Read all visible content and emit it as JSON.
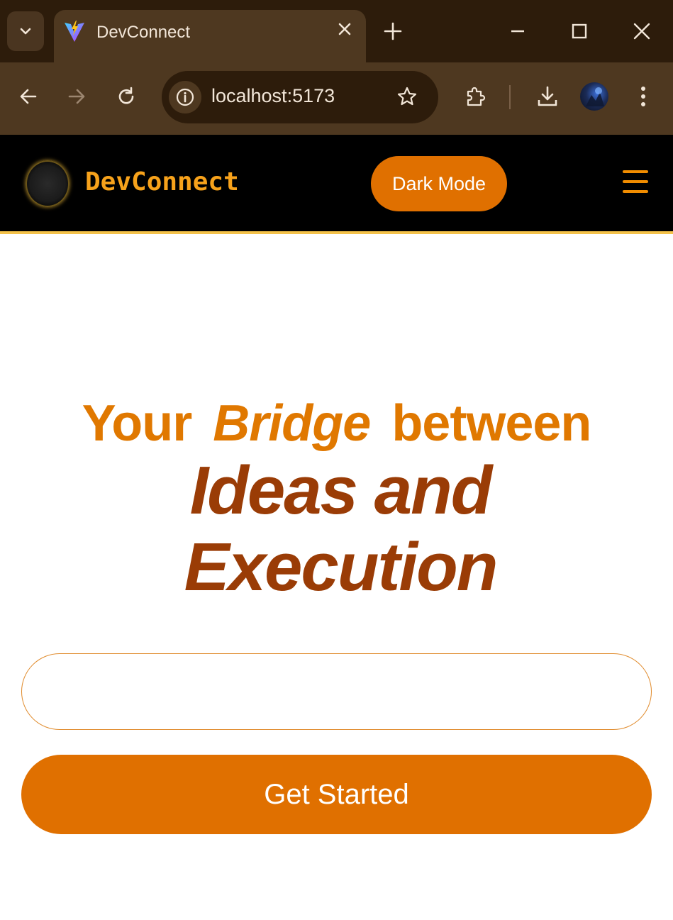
{
  "browser": {
    "tab": {
      "title": "DevConnect"
    },
    "address": {
      "url": "localhost:5173"
    },
    "icons": [
      "tab-search-icon",
      "vite-favicon-icon",
      "close-tab-icon",
      "new-tab-icon",
      "minimize-icon",
      "maximize-icon",
      "close-window-icon",
      "back-icon",
      "forward-icon",
      "reload-icon",
      "site-info-icon",
      "bookmark-star-icon",
      "extensions-icon",
      "download-icon",
      "profile-avatar",
      "more-menu-icon"
    ]
  },
  "navbar": {
    "brand": "DevConnect",
    "dark_mode_label": "Dark Mode",
    "menu_icon": "hamburger-icon",
    "border_color": "#f4c24a"
  },
  "hero": {
    "line1_part1": "Your",
    "line1_part2": "Bridge",
    "line1_part3": "between",
    "line2": "Ideas and",
    "line3": "Execution",
    "input_value": "",
    "input_placeholder": "",
    "cta_label": "Get Started"
  },
  "colors": {
    "accent": "#e07000",
    "heading_light": "#e07800",
    "heading_dark": "#9a3c06",
    "brand_text": "#f7a21b",
    "chrome_dark": "#2d1c0b",
    "chrome_mid": "#4e3820"
  }
}
